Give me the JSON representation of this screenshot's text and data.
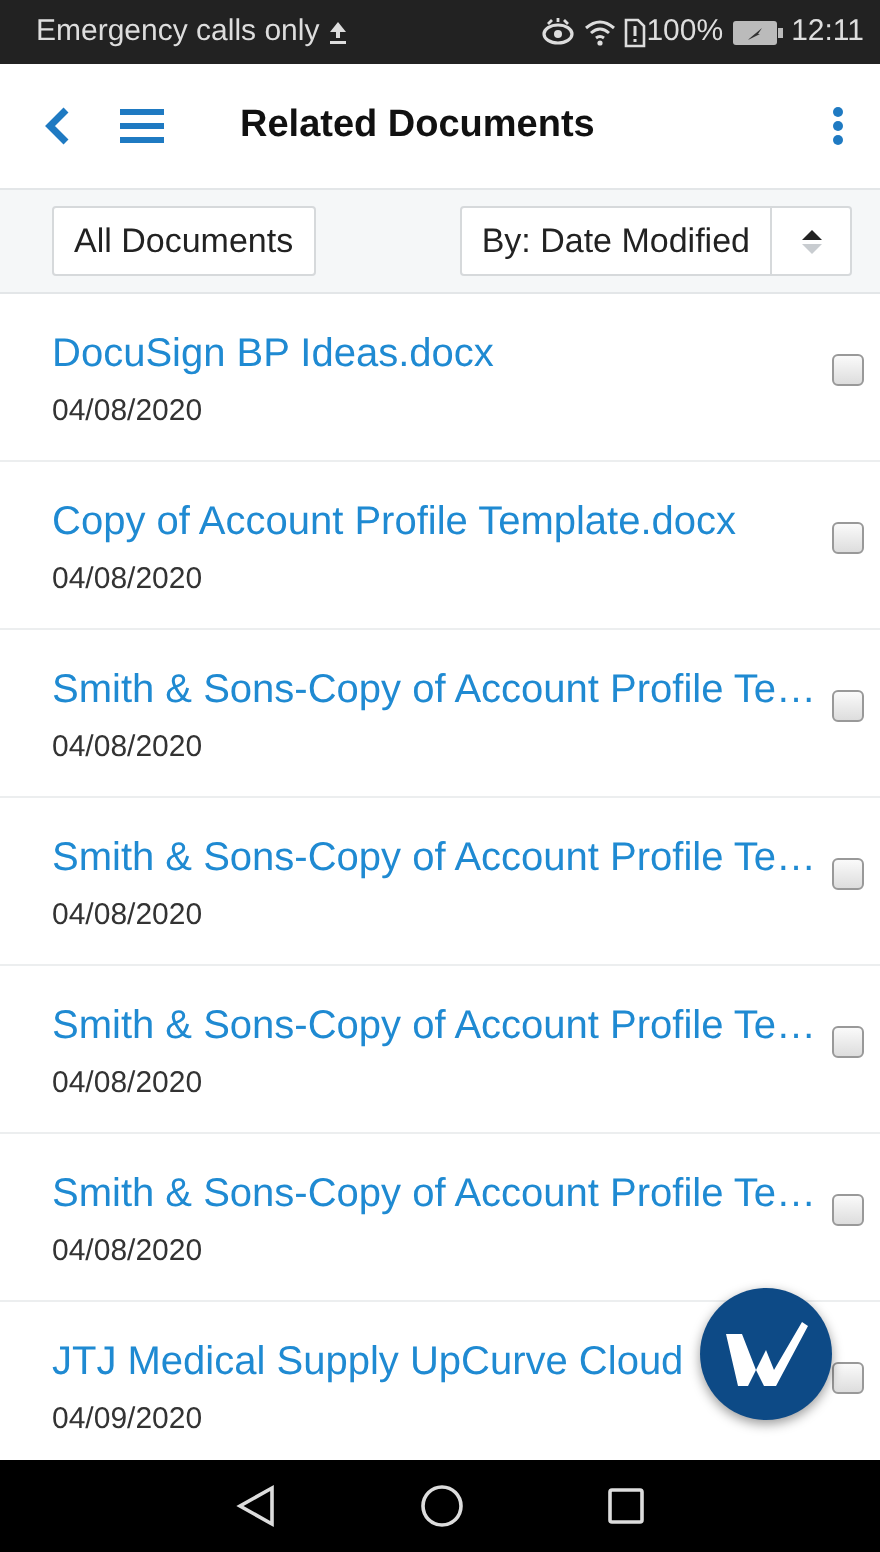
{
  "status_bar": {
    "carrier": "Emergency calls only",
    "battery": "100%",
    "time": "12:11"
  },
  "app_bar": {
    "title": "Related Documents"
  },
  "filter_bar": {
    "filter": "All Documents",
    "sort": "By: Date Modified"
  },
  "documents": [
    {
      "name": "DocuSign BP Ideas.docx",
      "date": "04/08/2020",
      "checked": false
    },
    {
      "name": "Copy of Account Profile Template.docx",
      "date": "04/08/2020",
      "checked": false
    },
    {
      "name": "Smith & Sons-Copy of Account Profile Te…",
      "date": "04/08/2020",
      "checked": false
    },
    {
      "name": "Smith & Sons-Copy of Account Profile Te…",
      "date": "04/08/2020",
      "checked": false
    },
    {
      "name": "Smith & Sons-Copy of Account Profile Te…",
      "date": "04/08/2020",
      "checked": false
    },
    {
      "name": "Smith & Sons-Copy of Account Profile Te…",
      "date": "04/08/2020",
      "checked": false
    },
    {
      "name": "JTJ Medical Supply UpCurve Cloud",
      "date": "04/09/2020",
      "checked": false
    }
  ]
}
